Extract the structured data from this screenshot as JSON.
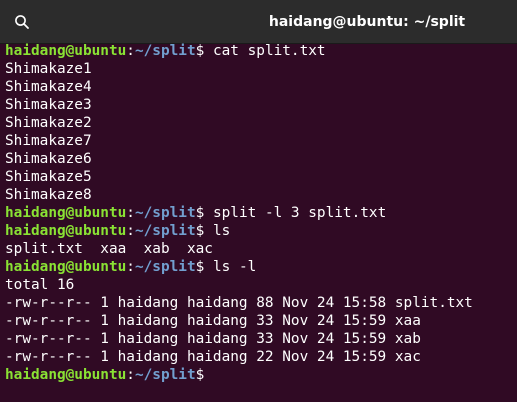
{
  "window": {
    "title": "haidang@ubuntu: ~/split"
  },
  "colors": {
    "background": "#300a24",
    "titlebar": "#2c2c2c",
    "prompt_user": "#8ae234",
    "prompt_path": "#729fcf",
    "text": "#ffffff"
  },
  "icons": {
    "search": "search-icon"
  },
  "prompt": {
    "user": "haidang@ubuntu",
    "separator": ":",
    "path": "~/split",
    "dollar": "$"
  },
  "lines": [
    {
      "type": "prompt",
      "cmd": " cat split.txt"
    },
    {
      "type": "output",
      "text": "Shimakaze1"
    },
    {
      "type": "output",
      "text": "Shimakaze4"
    },
    {
      "type": "output",
      "text": "Shimakaze3"
    },
    {
      "type": "output",
      "text": "Shimakaze2"
    },
    {
      "type": "output",
      "text": "Shimakaze7"
    },
    {
      "type": "output",
      "text": "Shimakaze6"
    },
    {
      "type": "output",
      "text": "Shimakaze5"
    },
    {
      "type": "output",
      "text": "Shimakaze8"
    },
    {
      "type": "prompt",
      "cmd": " split -l 3 split.txt"
    },
    {
      "type": "prompt",
      "cmd": " ls"
    },
    {
      "type": "output",
      "text": "split.txt  xaa  xab  xac"
    },
    {
      "type": "prompt",
      "cmd": " ls -l"
    },
    {
      "type": "output",
      "text": "total 16"
    },
    {
      "type": "output",
      "text": "-rw-r--r-- 1 haidang haidang 88 Nov 24 15:58 split.txt"
    },
    {
      "type": "output",
      "text": "-rw-r--r-- 1 haidang haidang 33 Nov 24 15:59 xaa"
    },
    {
      "type": "output",
      "text": "-rw-r--r-- 1 haidang haidang 33 Nov 24 15:59 xab"
    },
    {
      "type": "output",
      "text": "-rw-r--r-- 1 haidang haidang 22 Nov 24 15:59 xac"
    },
    {
      "type": "prompt",
      "cmd": ""
    }
  ]
}
